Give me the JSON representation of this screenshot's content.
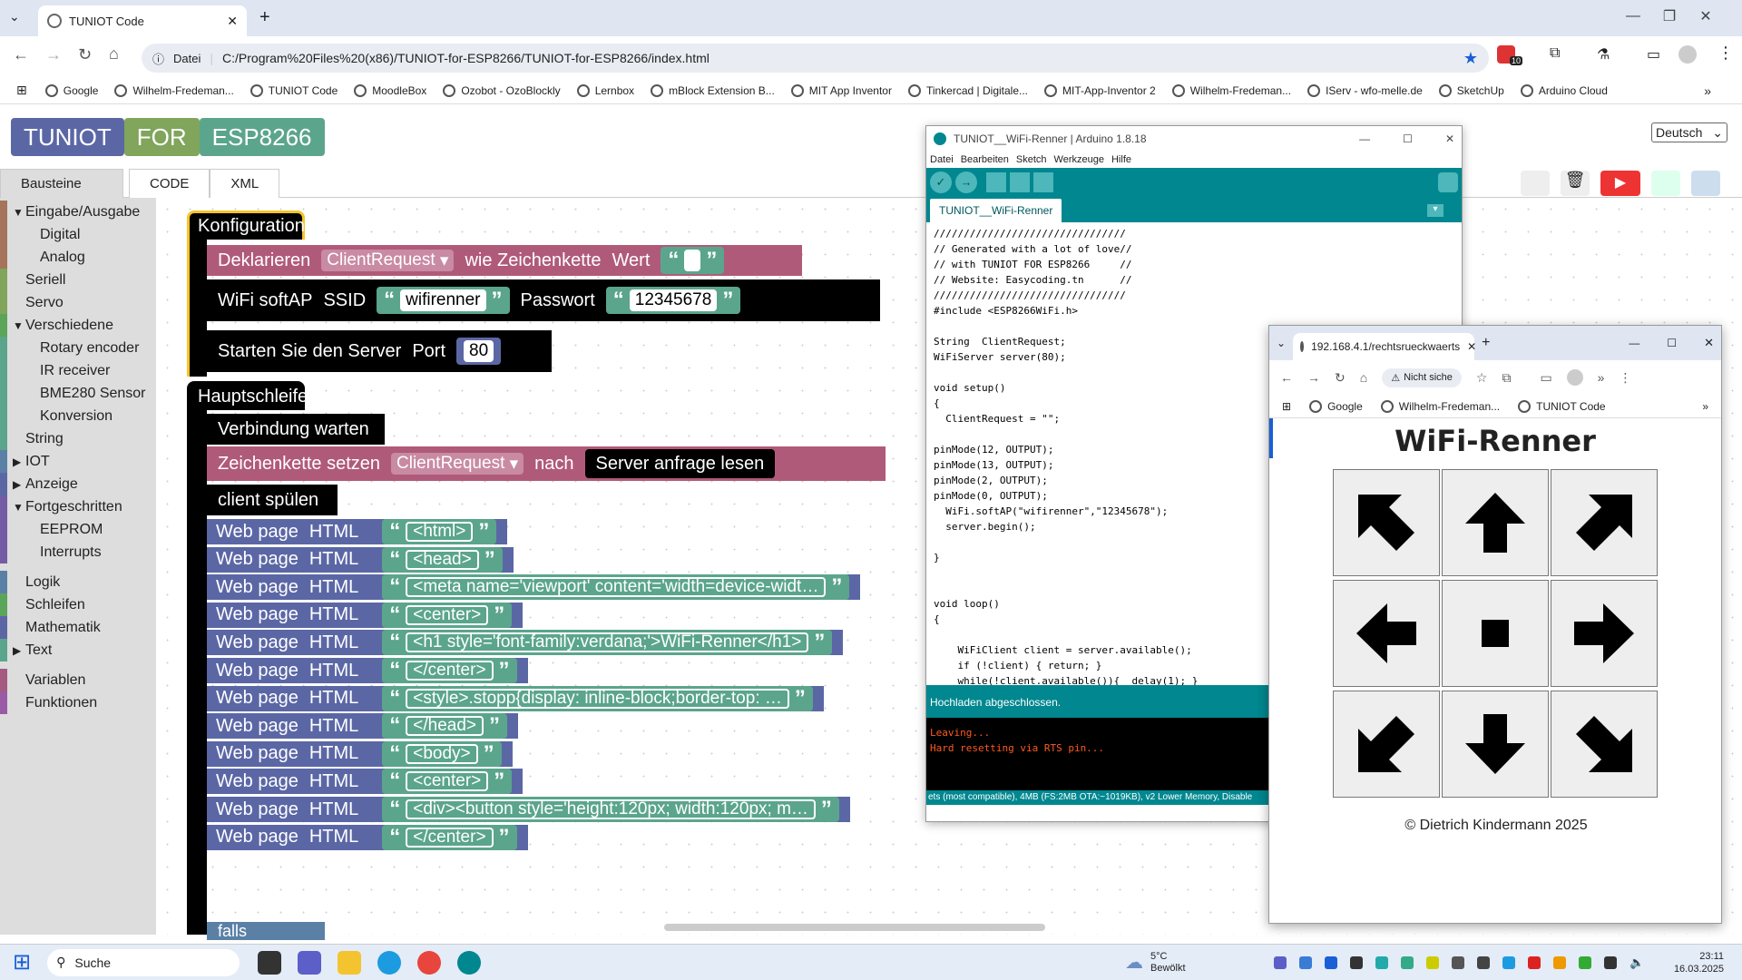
{
  "browser": {
    "tab_title": "TUNIOT Code",
    "address_prefix": "Datei",
    "url": "C:/Program%20Files%20(x86)/TUNIOT-for-ESP8266/TUNIOT-for-ESP8266/index.html",
    "extension_badge": "10",
    "bookmarks": [
      "Google",
      "Wilhelm-Fredeman...",
      "TUNIOT Code",
      "MoodleBox",
      "Ozobot - OzoBlockly",
      "Lernbox",
      "mBlock Extension B...",
      "MIT App Inventor",
      "Tinkercad | Digitale...",
      "MIT-App-Inventor 2",
      "Wilhelm-Fredeman...",
      "IServ - wfo-melle.de",
      "SketchUp",
      "Arduino Cloud"
    ]
  },
  "app": {
    "logo": [
      "TUNIOT",
      "FOR",
      "ESP8266"
    ],
    "language": "Deutsch",
    "tabs": [
      "Bausteine",
      "CODE",
      "XML"
    ],
    "categories": [
      {
        "label": "Eingabe/Ausgabe",
        "indent": 0,
        "expanded": true,
        "color": "#a5745b"
      },
      {
        "label": "Digital",
        "indent": 1,
        "color": "#a5745b"
      },
      {
        "label": "Analog",
        "indent": 1,
        "color": "#a5745b"
      },
      {
        "label": "Seriell",
        "indent": 0,
        "color": "#80a55b"
      },
      {
        "label": "Servo",
        "indent": 0,
        "color": "#80a55b"
      },
      {
        "label": "Verschiedene",
        "indent": 0,
        "expanded": true,
        "color": "#5ba55b"
      },
      {
        "label": "Rotary encoder",
        "indent": 1,
        "color": "#5ba58c"
      },
      {
        "label": "IR receiver",
        "indent": 1,
        "color": "#5ba58c"
      },
      {
        "label": "BME280 Sensor",
        "indent": 1,
        "color": "#5ba58c"
      },
      {
        "label": "Konversion",
        "indent": 1,
        "color": "#5ba58c"
      },
      {
        "label": "String",
        "indent": 0,
        "color": "#5ba58c"
      },
      {
        "label": "IOT",
        "indent": 0,
        "expanded": false,
        "color": "#5b80a5"
      },
      {
        "label": "Anzeige",
        "indent": 0,
        "expanded": false,
        "color": "#5b67a5"
      },
      {
        "label": "Fortgeschritten",
        "indent": 0,
        "expanded": true,
        "color": "#745ba5"
      },
      {
        "label": "EEPROM",
        "indent": 1,
        "color": "#745ba5"
      },
      {
        "label": "Interrupts",
        "indent": 1,
        "color": "#745ba5"
      },
      {
        "label": "Logik",
        "indent": 0,
        "color": "#5b80a5"
      },
      {
        "label": "Schleifen",
        "indent": 0,
        "color": "#5ba55b"
      },
      {
        "label": "Mathematik",
        "indent": 0,
        "color": "#5b67a5"
      },
      {
        "label": "Text",
        "indent": 0,
        "expanded": false,
        "color": "#5ba58c"
      },
      {
        "label": "Variablen",
        "indent": 0,
        "color": "#a55b80"
      },
      {
        "label": "Funktionen",
        "indent": 0,
        "color": "#995ba5"
      }
    ],
    "blocks": {
      "config": "Konfiguration",
      "declare": {
        "label": "Deklarieren",
        "var": "ClientRequest",
        "as": "wie Zeichenkette",
        "value": "Wert"
      },
      "softap": {
        "label": "WiFi softAP",
        "ssid_label": "SSID",
        "ssid": "wifirenner",
        "pass_label": "Passwort",
        "pass": "12345678"
      },
      "server": {
        "label": "Starten Sie den Server",
        "port_label": "Port",
        "port": "80"
      },
      "loop": "Hauptschleife",
      "wait": "Verbindung warten",
      "setstr": {
        "label": "Zeichenkette setzen",
        "var": "ClientRequest",
        "to": "nach",
        "read": "Server anfrage lesen"
      },
      "flush": "client spülen",
      "web_label": "Web page",
      "web_html": "HTML",
      "web_items": [
        "<html>",
        "<head>",
        "<meta name='viewport' content='width=device-widt…",
        "<center>",
        "<h1 style='font-family:verdana;'>WiFi-Renner</h1>",
        "</center>",
        "<style>.stopp{display: inline-block;border-top: …",
        "</head>",
        "<body>",
        "<center>",
        "<div><button style='height:120px; width:120px; m…",
        "</center>"
      ],
      "partial": "falls"
    }
  },
  "arduino": {
    "title": "TUNIOT__WiFi-Renner | Arduino 1.8.18",
    "menu": [
      "Datei",
      "Bearbeiten",
      "Sketch",
      "Werkzeuge",
      "Hilfe"
    ],
    "tab": "TUNIOT__WiFi-Renner",
    "code": "////////////////////////////////\n// Generated with a lot of love//\n// with TUNIOT FOR ESP8266     //\n// Website: Easycoding.tn      //\n////////////////////////////////\n#include <ESP8266WiFi.h>\n\nString  ClientRequest;\nWiFiServer server(80);\n\nvoid setup()\n{\n  ClientRequest = \"\";\n\npinMode(12, OUTPUT);\npinMode(13, OUTPUT);\npinMode(2, OUTPUT);\npinMode(0, OUTPUT);\n  WiFi.softAP(\"wifirenner\",\"12345678\");\n  server.begin();\n\n}\n\n\nvoid loop()\n{\n\n    WiFiClient client = server.available();\n    if (!client) { return; }\n    while(!client.available()){  delay(1); }",
    "status": "Hochladen abgeschlossen.",
    "console": [
      "Leaving...",
      "Hard resetting via RTS pin..."
    ],
    "board": "ets (most compatible), 4MB (FS:2MB OTA:~1019KB), v2 Lower Memory, Disable"
  },
  "mini": {
    "tab_title": "192.168.4.1/rechtsrueckwaerts",
    "security": "Nicht siche",
    "bookmarks": [
      "Google",
      "Wilhelm-Fredeman...",
      "TUNIOT Code"
    ],
    "heading": "WiFi-Renner",
    "footer": "© Dietrich Kindermann 2025",
    "grid": [
      "up-left-arrow-icon",
      "up-arrow-icon",
      "up-right-arrow-icon",
      "left-arrow-icon",
      "stop-square-icon",
      "right-arrow-icon",
      "down-left-arrow-icon",
      "down-arrow-icon",
      "down-right-arrow-icon"
    ]
  },
  "taskbar": {
    "search": "Suche",
    "weather_temp": "5°C",
    "weather_desc": "Bewölkt",
    "time": "23:11",
    "date": "16.03.2025"
  },
  "colors": {
    "text_block": "#b05a7a",
    "wifi_block": "#000000",
    "web_block": "#5b67a5",
    "string_block": "#5ba58c",
    "config_border": "#f7c427",
    "arduino_teal": "#00878f"
  }
}
